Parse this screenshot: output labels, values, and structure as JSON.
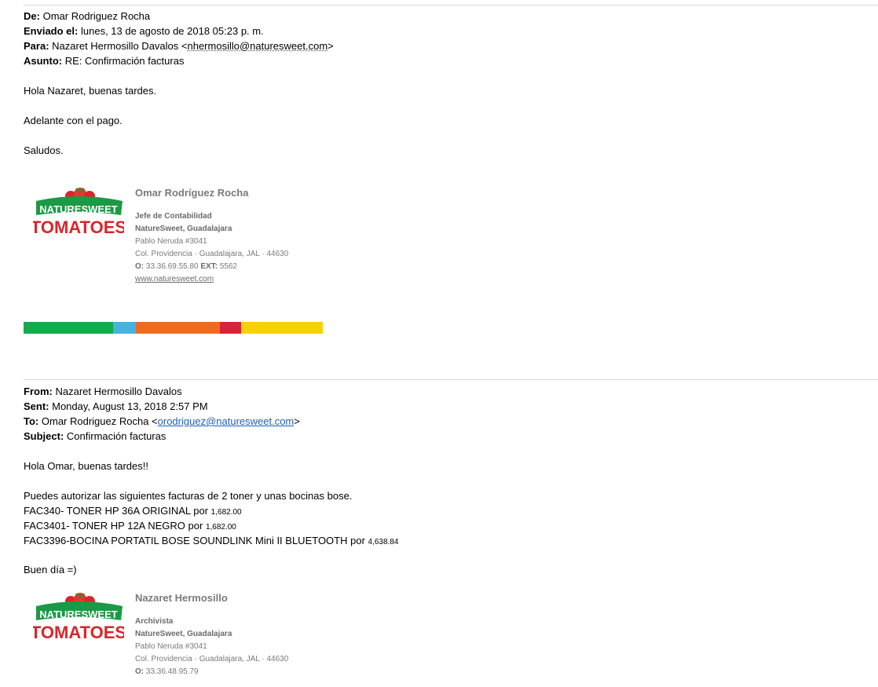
{
  "email1": {
    "from_label": "De:",
    "from": "Omar Rodriguez Rocha",
    "sent_label": "Enviado el:",
    "sent": "lunes, 13 de agosto de 2018 05:23 p. m.",
    "to_label": "Para:",
    "to_name": "Nazaret Hermosillo Davalos <",
    "to_email": "nhermosillo@naturesweet.com",
    "to_close": ">",
    "subject_label": "Asunto:",
    "subject": "RE: Confirmación facturas",
    "greeting": "Hola Nazaret, buenas tardes.",
    "body": "Adelante con el pago.",
    "closing": "Saludos.",
    "signature": {
      "name": "Omar Rodríguez Rocha",
      "title": "Jefe de Contabilidad",
      "company": "NatureSweet, Guadalajara",
      "address1": "Pablo Neruda #3041",
      "address2": "Col. Providencia · Guadalajara, JAL · 44630",
      "phone_label": "O:",
      "phone": "33.36.69.55.80",
      "ext_label": "EXT:",
      "ext": "5562",
      "website": "www.naturesweet.com"
    },
    "color_bar": [
      "#11ac4b",
      "#4ab0e0",
      "#ef6b22",
      "#d8213a",
      "#f7d200"
    ]
  },
  "email2": {
    "from_label": "From:",
    "from": "Nazaret Hermosillo Davalos",
    "sent_label": "Sent:",
    "sent": "Monday, August 13, 2018 2:57 PM",
    "to_label": "To:",
    "to_name": "Omar Rodriguez Rocha <",
    "to_email": "orodriguez@naturesweet.com",
    "to_close": ">",
    "subject_label": "Subject:",
    "subject": "Confirmación facturas",
    "greeting": "Hola Omar, buenas tardes!!",
    "intro": "Puedes autorizar las siguientes facturas de 2 toner y unas bocinas bose.",
    "invoices": [
      {
        "text": "FAC340- TONER HP 36A ORIGINAL por ",
        "amount": "1,682.00"
      },
      {
        "text": "FAC3401- TONER HP 12A NEGRO por ",
        "amount": "1,682.00"
      },
      {
        "text": "FAC3396-BOCINA PORTATIL BOSE SOUNDLINK Mini II BLUETOOTH por ",
        "amount": "4,638.84"
      }
    ],
    "closing": "Buen día =)",
    "signature": {
      "name": "Nazaret Hermosillo",
      "title": "Archivista",
      "company": "NatureSweet, Guadalajara",
      "address1": "Pablo Neruda #3041",
      "address2": "Col. Providencia · Guadalajara, JAL · 44630",
      "phone_label": "O:",
      "phone": "33.36.48.95.79"
    }
  },
  "logo": {
    "line1": "NATURESWEET",
    "line2": "TOMATOES"
  }
}
